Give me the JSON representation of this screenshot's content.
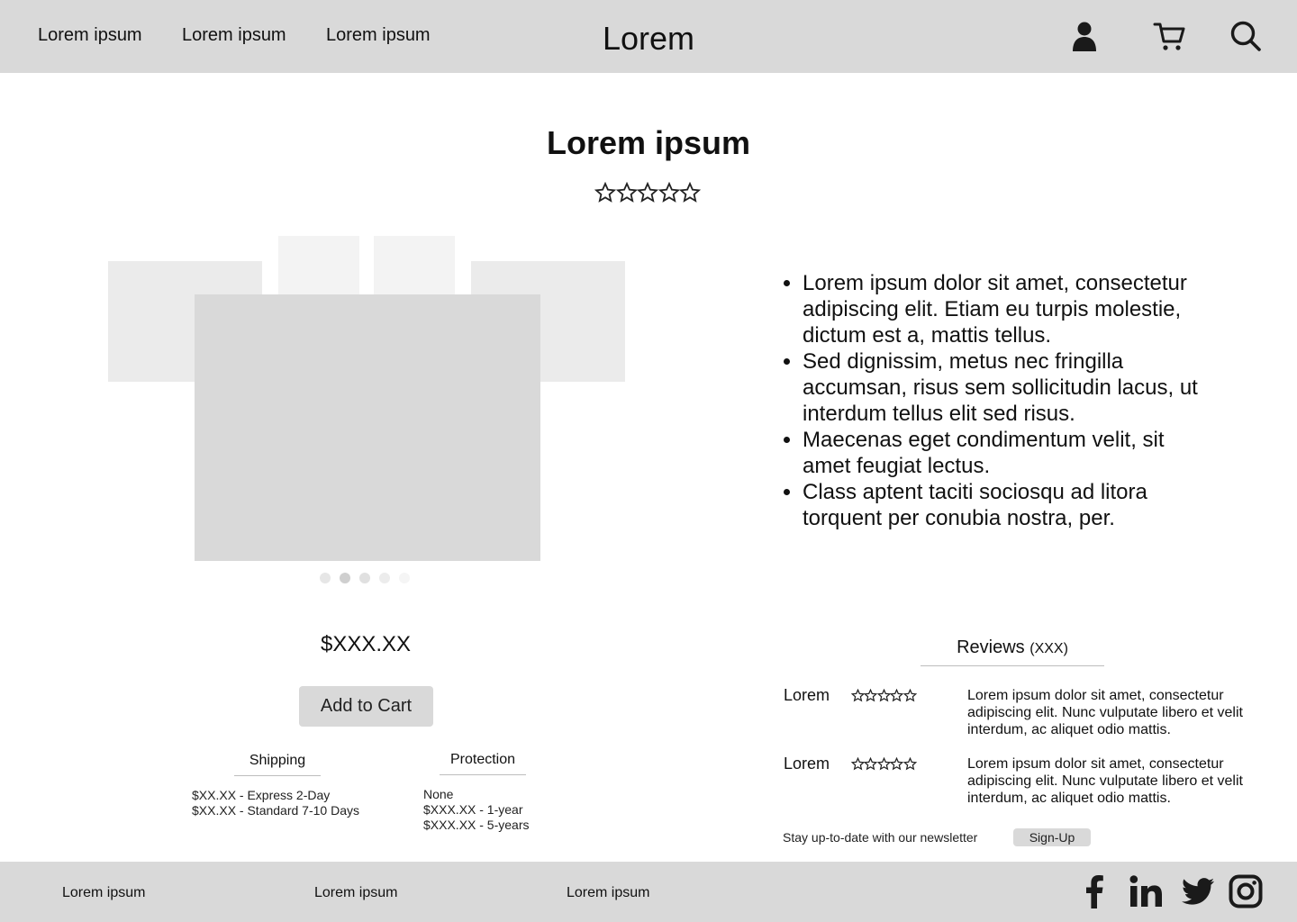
{
  "header": {
    "nav": [
      "Lorem ipsum",
      "Lorem ipsum",
      "Lorem ipsum"
    ],
    "brand": "Lorem",
    "icons": [
      "user-icon",
      "cart-icon",
      "search-icon"
    ]
  },
  "product": {
    "title": "Lorem ipsum",
    "rating_stars": 5,
    "price": "$XXX.XX",
    "add_to_cart": "Add to Cart",
    "carousel_dot_count": 5,
    "carousel_active_dot": 2
  },
  "shipping": {
    "title": "Shipping",
    "options": [
      "$XX.XX - Express 2-Day",
      "$XX.XX - Standard 7-10 Days"
    ]
  },
  "protection": {
    "title": "Protection",
    "options": [
      "None",
      "$XXX.XX - 1-year",
      "$XXX.XX - 5-years"
    ]
  },
  "features": [
    "Lorem ipsum dolor sit amet, consectetur adipiscing elit. Etiam eu turpis molestie, dictum est a, mattis tellus.",
    "Sed dignissim, metus nec fringilla accumsan, risus sem sollicitudin lacus, ut interdum tellus elit sed risus.",
    "Maecenas eget condimentum velit, sit amet feugiat lectus.",
    "Class aptent taciti sociosqu ad litora torquent per conubia nostra, per."
  ],
  "reviews": {
    "label": "Reviews",
    "count": "(XXX)",
    "items": [
      {
        "name": "Lorem",
        "stars": 5,
        "text": "Lorem ipsum dolor sit amet, consectetur adipiscing elit. Nunc vulputate libero et velit interdum, ac aliquet odio mattis."
      },
      {
        "name": "Lorem",
        "stars": 5,
        "text": "Lorem ipsum dolor sit amet, consectetur adipiscing elit. Nunc vulputate libero et velit interdum, ac aliquet odio mattis."
      }
    ]
  },
  "newsletter": {
    "text": "Stay up-to-date with our newsletter",
    "button": "Sign-Up"
  },
  "footer": {
    "links": [
      "Lorem ipsum",
      "Lorem ipsum",
      "Lorem ipsum"
    ],
    "social": [
      "facebook-icon",
      "linkedin-icon",
      "twitter-icon",
      "instagram-icon"
    ]
  },
  "colors": {
    "bar_bg": "#d9d9d9",
    "placeholder_dark": "#d9d9d9",
    "placeholder_mid": "#ebebeb",
    "placeholder_light": "#f3f3f3",
    "divider": "#bdbdbd"
  }
}
